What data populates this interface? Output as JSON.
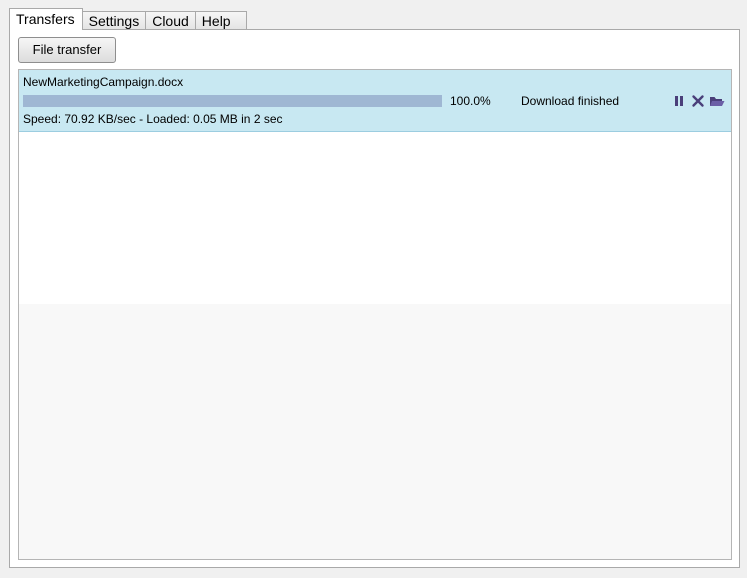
{
  "tabs": [
    {
      "label": "Transfers",
      "active": true
    },
    {
      "label": "Settings",
      "active": false
    },
    {
      "label": "Cloud",
      "active": false
    },
    {
      "label": "Help",
      "active": false
    }
  ],
  "toolbar": {
    "file_transfer_label": "File transfer"
  },
  "transfers": [
    {
      "filename": "NewMarketingCampaign.docx",
      "progress_percent": 100,
      "progress_text": "100.0%",
      "status": "Download finished",
      "stats": "Speed: 70.92 KB/sec - Loaded: 0.05 MB in 2 sec",
      "actions": [
        "pause-icon",
        "close-icon",
        "folder-open-icon"
      ]
    }
  ],
  "colors": {
    "window_bg": "#f0f0f0",
    "item_bg": "#c8e8f2",
    "progress_fill": "#9fb7d3",
    "icon_color": "#4a3f7a"
  }
}
